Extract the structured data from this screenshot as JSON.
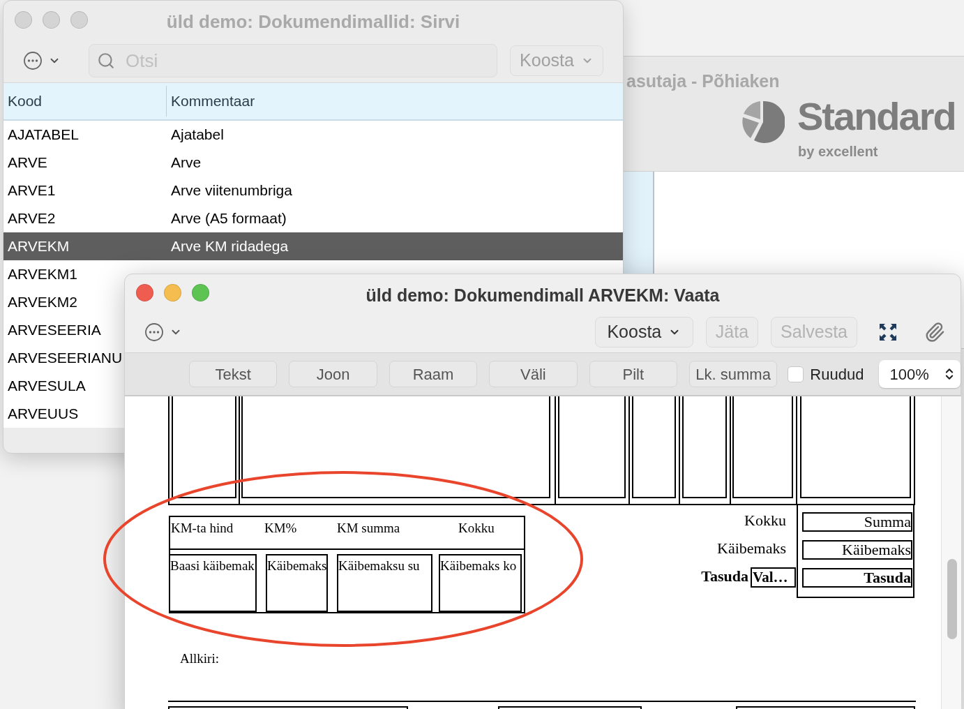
{
  "background_window": {
    "title": "asutaja - Põhiaken",
    "logo": {
      "name": "Standard",
      "tagline": "by excellent"
    }
  },
  "browse_window": {
    "title": "üld demo: Dokumendimallid: Sirvi",
    "active": false,
    "search": {
      "placeholder": "Otsi"
    },
    "build_button": "Koosta",
    "table": {
      "columns": [
        "Kood",
        "Kommentaar"
      ],
      "rows": [
        {
          "code": "AJATABEL",
          "comment": "Ajatabel",
          "selected": false
        },
        {
          "code": "ARVE",
          "comment": "Arve",
          "selected": false
        },
        {
          "code": "ARVE1",
          "comment": "Arve viitenumbriga",
          "selected": false
        },
        {
          "code": "ARVE2",
          "comment": "Arve (A5 formaat)",
          "selected": false
        },
        {
          "code": "ARVEKM",
          "comment": "Arve KM ridadega",
          "selected": true
        },
        {
          "code": "ARVEKM1",
          "selected": false
        },
        {
          "code": "ARVEKM2",
          "selected": false
        },
        {
          "code": "ARVESEERIA",
          "selected": false
        },
        {
          "code": "ARVESEERIANU",
          "selected": false
        },
        {
          "code": "ARVESULA",
          "selected": false
        },
        {
          "code": "ARVEUUS",
          "selected": false
        }
      ]
    }
  },
  "editor_window": {
    "title": "üld demo: Dokumendimall ARVEKM: Vaata",
    "active": true,
    "build_button": "Koosta",
    "buttons": [
      {
        "label": "Jäta",
        "disabled": true
      },
      {
        "label": "Salvesta",
        "disabled": true
      }
    ],
    "tools": [
      "Tekst",
      "Joon",
      "Raam",
      "Väli",
      "Pilt",
      "Lk. summa"
    ],
    "grid_checkbox": {
      "label": "Ruudud",
      "checked": false
    },
    "zoom": "100%",
    "document": {
      "vat_table": {
        "headers": [
          "KM-ta hind",
          "KM%",
          "KM summa",
          "Kokku"
        ],
        "fields": [
          "Baasi käibemak",
          "Käibemaks",
          "Käibemaksu su",
          "Käibemaks ko"
        ]
      },
      "totals": [
        {
          "label": "Kokku",
          "field": "Summa",
          "bold": false
        },
        {
          "label": "Käibemaks",
          "field": "Käibemaks",
          "bold": false
        },
        {
          "label": "Tasuda",
          "field": "Tasuda",
          "bold": true,
          "currency": "Val…"
        }
      ],
      "signature_label": "Allkiri:"
    }
  }
}
